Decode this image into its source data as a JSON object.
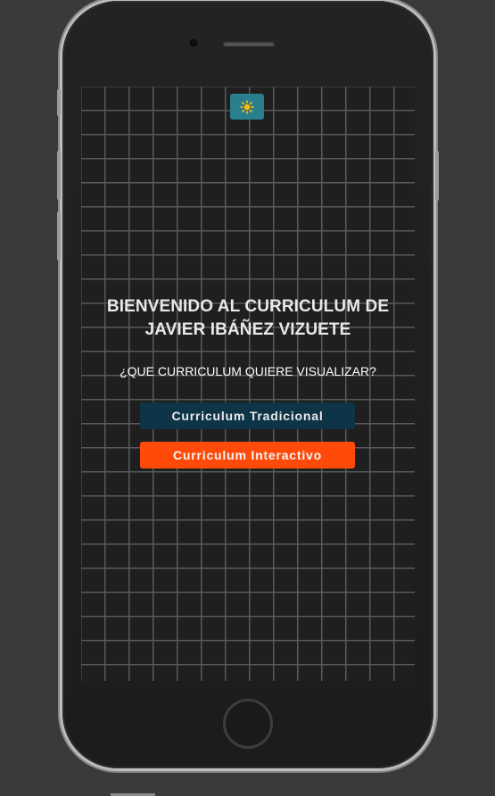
{
  "device": {
    "type": "smartphone-mockup"
  },
  "header": {
    "theme_toggle_icon": "sun-icon",
    "theme_toggle_color": "#2a7f8f"
  },
  "main": {
    "title_line_1": "BIENVENIDO AL CURRICULUM DE",
    "title_line_2": "JAVIER IBÁÑEZ VIZUETE",
    "question": "¿QUE CURRICULUM QUIERE VISUALIZAR?",
    "buttons": [
      {
        "label": "Curriculum Tradicional",
        "color": "#0d3447"
      },
      {
        "label": "Curriculum Interactivo",
        "color": "#ff4a0a"
      }
    ]
  },
  "colors": {
    "page_background": "#3a3a3a",
    "screen_background": "#1f1f1f",
    "grid_lines": "#5a5a5a"
  }
}
